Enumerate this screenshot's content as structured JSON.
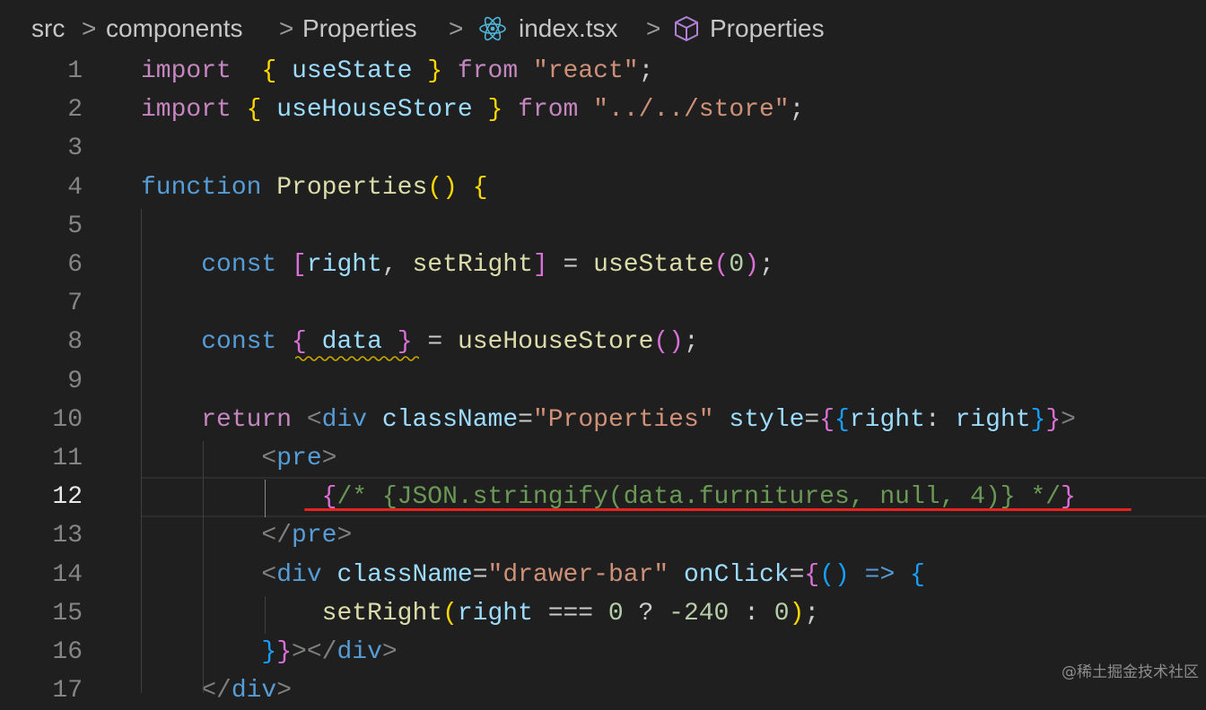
{
  "breadcrumb": {
    "items": [
      "src",
      "components",
      "Properties",
      "index.tsx",
      "Properties"
    ],
    "separator": ">"
  },
  "editor": {
    "line_numbers": [
      "1",
      "2",
      "3",
      "4",
      "5",
      "6",
      "7",
      "8",
      "9",
      "10",
      "11",
      "12",
      "13",
      "14",
      "15",
      "16",
      "17"
    ],
    "active_line": "12",
    "lines": [
      [
        [
          "kw",
          "import"
        ],
        [
          "",
          "  "
        ],
        [
          "b1",
          "{"
        ],
        [
          "",
          " "
        ],
        [
          "var",
          "useState"
        ],
        [
          "",
          " "
        ],
        [
          "b1",
          "}"
        ],
        [
          "",
          " "
        ],
        [
          "kw",
          "from"
        ],
        [
          "",
          " "
        ],
        [
          "str",
          "\"react\""
        ],
        [
          "",
          ";"
        ]
      ],
      [
        [
          "kw",
          "import"
        ],
        [
          "",
          " "
        ],
        [
          "b1",
          "{"
        ],
        [
          "",
          " "
        ],
        [
          "var",
          "useHouseStore"
        ],
        [
          "",
          " "
        ],
        [
          "b1",
          "}"
        ],
        [
          "",
          " "
        ],
        [
          "kw",
          "from"
        ],
        [
          "",
          " "
        ],
        [
          "str",
          "\"../../store\""
        ],
        [
          "",
          ";"
        ]
      ],
      [],
      [
        [
          "kb",
          "function"
        ],
        [
          "",
          " "
        ],
        [
          "fn",
          "Properties"
        ],
        [
          "b1",
          "()"
        ],
        [
          "",
          " "
        ],
        [
          "b1",
          "{"
        ]
      ],
      [],
      [
        [
          "",
          "    "
        ],
        [
          "kb",
          "const"
        ],
        [
          "",
          " "
        ],
        [
          "b2",
          "["
        ],
        [
          "var",
          "right"
        ],
        [
          "",
          ", "
        ],
        [
          "fn",
          "setRight"
        ],
        [
          "b2",
          "]"
        ],
        [
          "",
          " = "
        ],
        [
          "fn",
          "useState"
        ],
        [
          "b2",
          "("
        ],
        [
          "num",
          "0"
        ],
        [
          "b2",
          ")"
        ],
        [
          "",
          ";"
        ]
      ],
      [],
      [
        [
          "",
          "    "
        ],
        [
          "kb",
          "const"
        ],
        [
          "",
          " "
        ],
        [
          "b2",
          "{"
        ],
        [
          "",
          " "
        ],
        [
          "var",
          "data"
        ],
        [
          "",
          " "
        ],
        [
          "b2",
          "}"
        ],
        [
          "",
          " = "
        ],
        [
          "fn",
          "useHouseStore"
        ],
        [
          "b2",
          "()"
        ],
        [
          "",
          ";"
        ]
      ],
      [],
      [
        [
          "",
          "    "
        ],
        [
          "kw",
          "return"
        ],
        [
          "",
          " "
        ],
        [
          "punc",
          "<"
        ],
        [
          "tag",
          "div"
        ],
        [
          "",
          " "
        ],
        [
          "attr",
          "className"
        ],
        [
          "",
          "="
        ],
        [
          "str",
          "\"Properties\""
        ],
        [
          "",
          " "
        ],
        [
          "attr",
          "style"
        ],
        [
          "",
          "="
        ],
        [
          "b2",
          "{"
        ],
        [
          "b3",
          "{"
        ],
        [
          "var",
          "right"
        ],
        [
          "",
          ": "
        ],
        [
          "var",
          "right"
        ],
        [
          "b3",
          "}"
        ],
        [
          "b2",
          "}"
        ],
        [
          "punc",
          ">"
        ]
      ],
      [
        [
          "",
          "        "
        ],
        [
          "punc",
          "<"
        ],
        [
          "tag",
          "pre"
        ],
        [
          "punc",
          ">"
        ]
      ],
      [
        [
          "",
          "            "
        ],
        [
          "b2",
          "{"
        ],
        [
          "cmt",
          "/* {JSON.stringify(data.furnitures, null, 4)} */"
        ],
        [
          "b2",
          "}"
        ]
      ],
      [
        [
          "",
          "        "
        ],
        [
          "punc",
          "</"
        ],
        [
          "tag",
          "pre"
        ],
        [
          "punc",
          ">"
        ]
      ],
      [
        [
          "",
          "        "
        ],
        [
          "punc",
          "<"
        ],
        [
          "tag",
          "div"
        ],
        [
          "",
          " "
        ],
        [
          "attr",
          "className"
        ],
        [
          "",
          "="
        ],
        [
          "str",
          "\"drawer-bar\""
        ],
        [
          "",
          " "
        ],
        [
          "attr",
          "onClick"
        ],
        [
          "",
          "="
        ],
        [
          "b2",
          "{"
        ],
        [
          "b3",
          "()"
        ],
        [
          "",
          " "
        ],
        [
          "kb",
          "=>"
        ],
        [
          "",
          " "
        ],
        [
          "b3",
          "{"
        ]
      ],
      [
        [
          "",
          "            "
        ],
        [
          "fn",
          "setRight"
        ],
        [
          "b1",
          "("
        ],
        [
          "var",
          "right"
        ],
        [
          "",
          " === "
        ],
        [
          "num",
          "0"
        ],
        [
          "",
          " ? "
        ],
        [
          "num",
          "-240"
        ],
        [
          "",
          " : "
        ],
        [
          "num",
          "0"
        ],
        [
          "b1",
          ")"
        ],
        [
          "",
          ";"
        ]
      ],
      [
        [
          "",
          "        "
        ],
        [
          "b3",
          "}"
        ],
        [
          "b2",
          "}"
        ],
        [
          "punc",
          "></"
        ],
        [
          "tag",
          "div"
        ],
        [
          "punc",
          ">"
        ]
      ],
      [
        [
          "",
          "    "
        ],
        [
          "punc",
          "</"
        ],
        [
          "tag",
          "div"
        ],
        [
          "punc",
          ">"
        ]
      ]
    ]
  },
  "colors": {
    "background": "#1f1f1f",
    "keyword_purple": "#c586c0",
    "keyword_blue": "#569cd6",
    "function_yellow": "#dcdcaa",
    "variable_blue": "#9cdcfe",
    "string_orange": "#ce9178",
    "comment_green": "#6a9955",
    "annotation_red": "#e8231d"
  },
  "icons": {
    "file": "react-icon",
    "symbol": "cube-icon"
  },
  "watermark": "@稀土掘金技术社区"
}
